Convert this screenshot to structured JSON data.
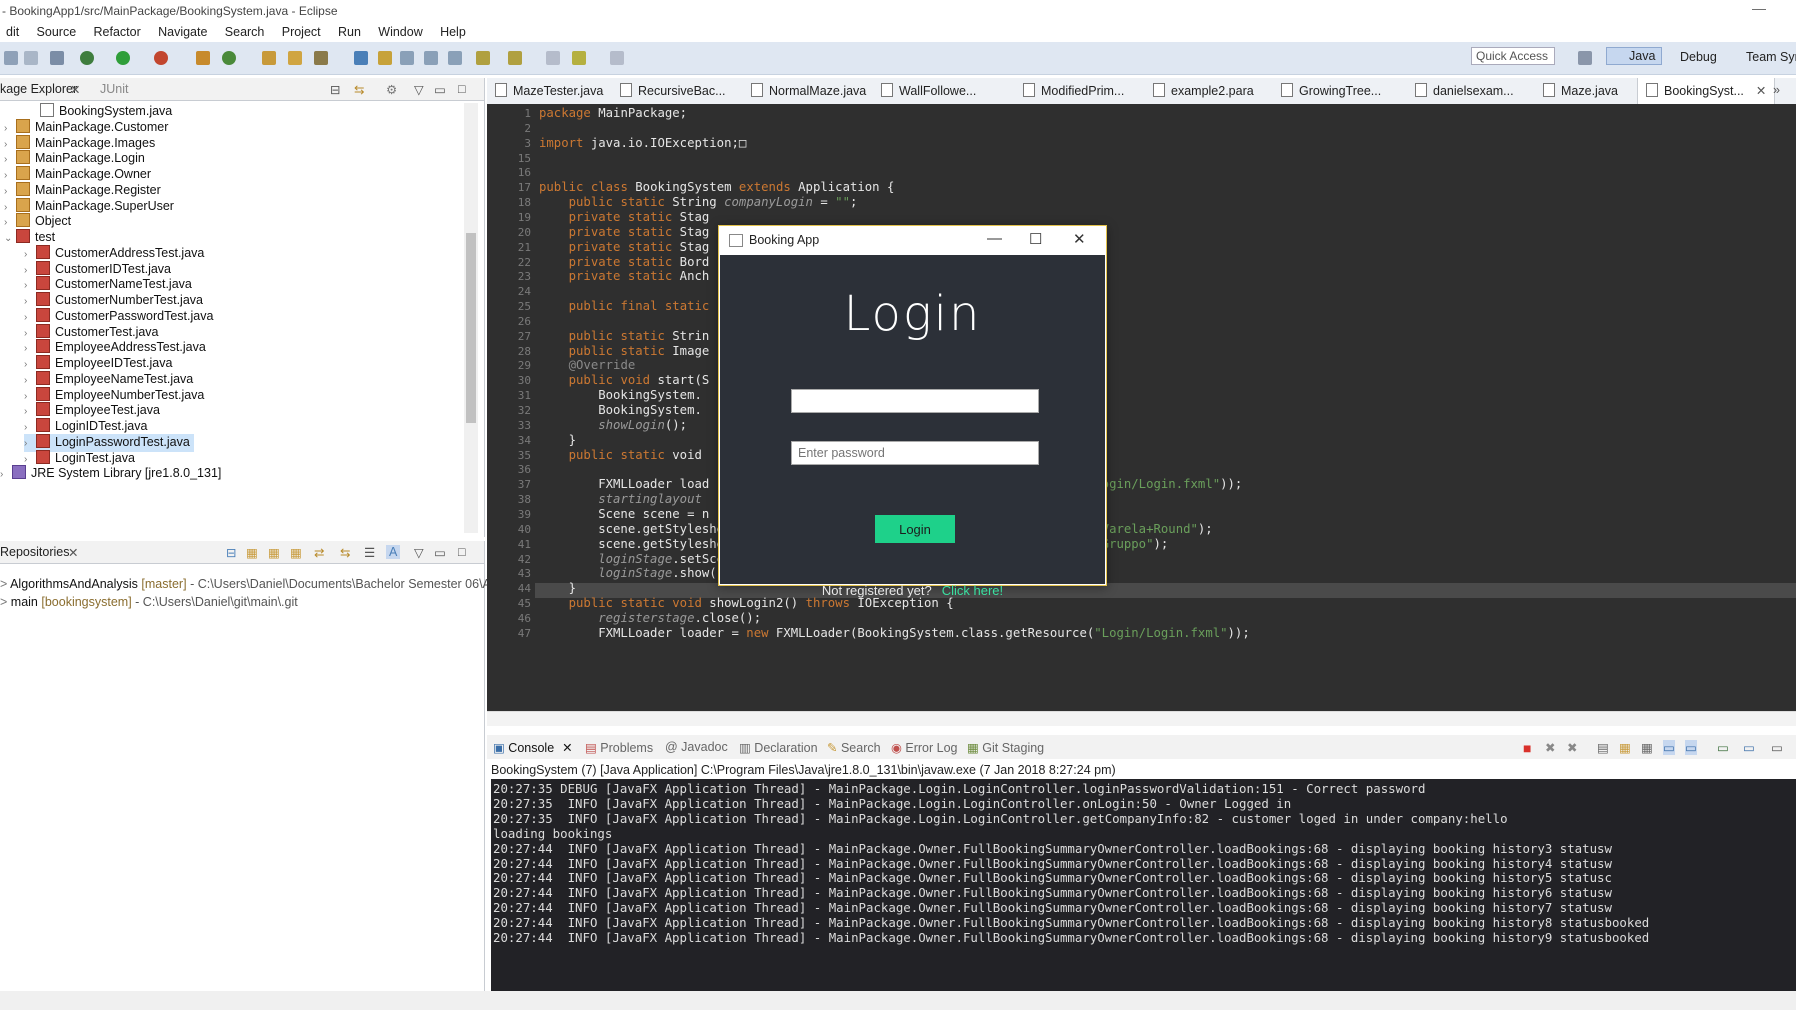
{
  "window": {
    "title": "- BookingApp1/src/MainPackage/BookingSystem.java - Eclipse",
    "minimize": "—"
  },
  "menu": [
    "dit",
    "Source",
    "Refactor",
    "Navigate",
    "Search",
    "Project",
    "Run",
    "Window",
    "Help"
  ],
  "toolbar": {
    "quick_access": "Quick Access",
    "perspectives": [
      "Java",
      "Debug",
      "Team Syr"
    ]
  },
  "package_explorer": {
    "tabs": [
      "kage Explorer",
      "JUnit"
    ],
    "items": [
      {
        "label": "BookingSystem.java",
        "type": "java",
        "indent": 2
      },
      {
        "label": "MainPackage.Customer",
        "type": "pkg",
        "indent": 1
      },
      {
        "label": "MainPackage.Images",
        "type": "pkg",
        "indent": 1
      },
      {
        "label": "MainPackage.Login",
        "type": "pkg",
        "indent": 1
      },
      {
        "label": "MainPackage.Owner",
        "type": "pkg",
        "indent": 1
      },
      {
        "label": "MainPackage.Register",
        "type": "pkg",
        "indent": 1
      },
      {
        "label": "MainPackage.SuperUser",
        "type": "pkg",
        "indent": 1
      },
      {
        "label": "Object",
        "type": "pkg",
        "indent": 1
      },
      {
        "label": "test",
        "type": "test",
        "indent": 1
      },
      {
        "label": "CustomerAddressTest.java",
        "type": "test",
        "indent": 2
      },
      {
        "label": "CustomerIDTest.java",
        "type": "test",
        "indent": 2
      },
      {
        "label": "CustomerNameTest.java",
        "type": "test",
        "indent": 2
      },
      {
        "label": "CustomerNumberTest.java",
        "type": "test",
        "indent": 2
      },
      {
        "label": "CustomerPasswordTest.java",
        "type": "test",
        "indent": 2
      },
      {
        "label": "CustomerTest.java",
        "type": "test",
        "indent": 2
      },
      {
        "label": "EmployeeAddressTest.java",
        "type": "test",
        "indent": 2
      },
      {
        "label": "EmployeeIDTest.java",
        "type": "test",
        "indent": 2
      },
      {
        "label": "EmployeeNameTest.java",
        "type": "test",
        "indent": 2
      },
      {
        "label": "EmployeeNumberTest.java",
        "type": "test",
        "indent": 2
      },
      {
        "label": "EmployeeTest.java",
        "type": "test",
        "indent": 2
      },
      {
        "label": "LoginIDTest.java",
        "type": "test",
        "indent": 2
      },
      {
        "label": "LoginPasswordTest.java",
        "type": "test",
        "indent": 2,
        "selected": true
      },
      {
        "label": "LoginTest.java",
        "type": "test",
        "indent": 2
      },
      {
        "label": "JRE System Library [jre1.8.0_131]",
        "type": "jre",
        "indent": 0
      }
    ]
  },
  "repositories": {
    "tab": "Repositories",
    "items": [
      {
        "name": "AlgorithmsAndAnalysis",
        "branch": "[master]",
        "path": "- C:\\Users\\Daniel\\Documents\\Bachelor Semester 06\\Alg"
      },
      {
        "name": "main",
        "branch": "[bookingsystem]",
        "path": "- C:\\Users\\Daniel\\git\\main\\.git"
      }
    ]
  },
  "editor_tabs": [
    "MazeTester.java",
    "RecursiveBac...",
    "NormalMaze.java",
    "WallFollowe...",
    "ModifiedPrim...",
    "example2.para",
    "GrowingTree...",
    "danielsexam...",
    "Maze.java",
    "BookingSyst..."
  ],
  "code_lines": [
    {
      "n": "1",
      "t": "package MainPackage;"
    },
    {
      "n": "2",
      "t": ""
    },
    {
      "n": "3",
      "t": "import java.io.IOException;□"
    },
    {
      "n": "15",
      "t": ""
    },
    {
      "n": "16",
      "t": ""
    },
    {
      "n": "17",
      "t": "public class BookingSystem extends Application {"
    },
    {
      "n": "18",
      "t": "    public static String companyLogin = \"\";"
    },
    {
      "n": "19",
      "t": "    private static Stag"
    },
    {
      "n": "20",
      "t": "    private static Stag"
    },
    {
      "n": "21",
      "t": "    private static Stag"
    },
    {
      "n": "22",
      "t": "    private static Bord"
    },
    {
      "n": "23",
      "t": "    private static Anch"
    },
    {
      "n": "24",
      "t": ""
    },
    {
      "n": "25",
      "t": "    public final static                                             ss);"
    },
    {
      "n": "26",
      "t": ""
    },
    {
      "n": "27",
      "t": "    public static Strin"
    },
    {
      "n": "28",
      "t": "    public static Image"
    },
    {
      "n": "29",
      "t": "    @Override"
    },
    {
      "n": "30",
      "t": "    public void start(S"
    },
    {
      "n": "31",
      "t": "        BookingSystem."
    },
    {
      "n": "32",
      "t": "        BookingSystem."
    },
    {
      "n": "33",
      "t": "        showLogin();"
    },
    {
      "n": "34",
      "t": "    }"
    },
    {
      "n": "35",
      "t": "    public static void"
    },
    {
      "n": "36",
      "t": ""
    },
    {
      "n": "37",
      "t": "        FXMLLoader load                                               rce(\"Login/Login.fxml\"));"
    },
    {
      "n": "38",
      "t": "        startinglayout"
    },
    {
      "n": "39",
      "t": "        Scene scene = n"
    },
    {
      "n": "40",
      "t": "        scene.getStylesheets().add(\"https://fonts.googleapis.com/css?family=Varela+Round\");"
    },
    {
      "n": "41",
      "t": "        scene.getStylesheets().add(\"https://fonts.googleapis.com/css?family=Gruppo\");"
    },
    {
      "n": "42",
      "t": "        loginStage.setScene(scene);"
    },
    {
      "n": "43",
      "t": "        loginStage.show();"
    },
    {
      "n": "44",
      "t": "    }"
    },
    {
      "n": "45",
      "t": "    public static void showLogin2() throws IOException {"
    },
    {
      "n": "46",
      "t": "        registerstage.close();"
    },
    {
      "n": "47",
      "t": "        FXMLLoader loader = new FXMLLoader(BookingSystem.class.getResource(\"Login/Login.fxml\"));"
    }
  ],
  "console_tabs": [
    "Console",
    "Problems",
    "Javadoc",
    "Declaration",
    "Search",
    "Error Log",
    "Git Staging"
  ],
  "console_header": "BookingSystem (7) [Java Application] C:\\Program Files\\Java\\jre1.8.0_131\\bin\\javaw.exe (7 Jan 2018 8:27:24 pm)",
  "console_lines": [
    "20:27:35 DEBUG [JavaFX Application Thread] - MainPackage.Login.LoginController.loginPasswordValidation:151 - Correct password",
    "20:27:35  INFO [JavaFX Application Thread] - MainPackage.Login.LoginController.onLogin:50 - Owner Logged in",
    "20:27:35  INFO [JavaFX Application Thread] - MainPackage.Login.LoginController.getCompanyInfo:82 - customer loged in under company:hello",
    "loading bookings",
    "20:27:44  INFO [JavaFX Application Thread] - MainPackage.Owner.FullBookingSummaryOwnerController.loadBookings:68 - displaying booking history3 statusw",
    "20:27:44  INFO [JavaFX Application Thread] - MainPackage.Owner.FullBookingSummaryOwnerController.loadBookings:68 - displaying booking history4 statusw",
    "20:27:44  INFO [JavaFX Application Thread] - MainPackage.Owner.FullBookingSummaryOwnerController.loadBookings:68 - displaying booking history5 statusc",
    "20:27:44  INFO [JavaFX Application Thread] - MainPackage.Owner.FullBookingSummaryOwnerController.loadBookings:68 - displaying booking history6 statusw",
    "20:27:44  INFO [JavaFX Application Thread] - MainPackage.Owner.FullBookingSummaryOwnerController.loadBookings:68 - displaying booking history7 statusw",
    "20:27:44  INFO [JavaFX Application Thread] - MainPackage.Owner.FullBookingSummaryOwnerController.loadBookings:68 - displaying booking history8 statusbooked",
    "20:27:44  INFO [JavaFX Application Thread] - MainPackage.Owner.FullBookingSummaryOwnerController.loadBookings:68 - displaying booking history9 statusbooked"
  ],
  "dialog": {
    "title": "Booking App",
    "heading": "Login",
    "username_value": "",
    "password_placeholder": "Enter password",
    "login_button": "Login",
    "not_registered": "Not registered yet?",
    "click_here": "Click here!",
    "accent": "#1ed18a",
    "background": "#2c3038"
  }
}
